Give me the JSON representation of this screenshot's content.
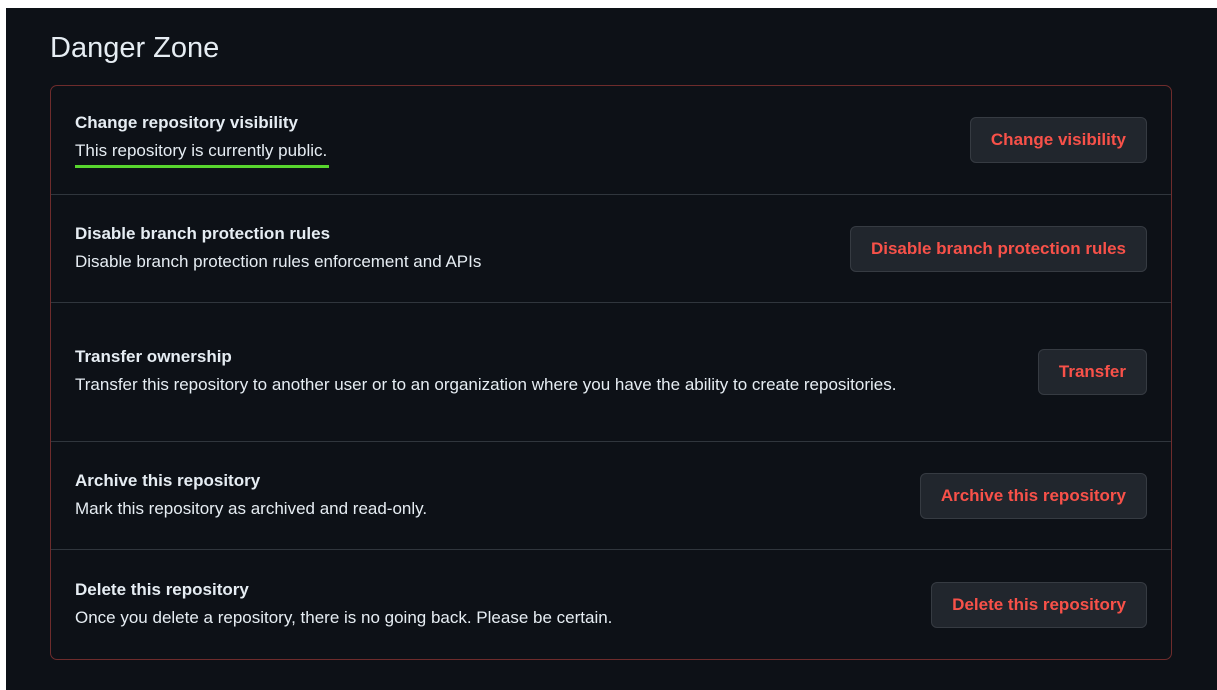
{
  "danger_zone": {
    "title": "Danger Zone",
    "accent_color": "#f85149",
    "highlight_color": "#58d62e",
    "items": [
      {
        "title": "Change repository visibility",
        "description": "This repository is currently public.",
        "button": "Change visibility",
        "highlighted": true
      },
      {
        "title": "Disable branch protection rules",
        "description": "Disable branch protection rules enforcement and APIs",
        "button": "Disable branch protection rules"
      },
      {
        "title": "Transfer ownership",
        "description": "Transfer this repository to another user or to an organization where you have the ability to create repositories.",
        "button": "Transfer"
      },
      {
        "title": "Archive this repository",
        "description": "Mark this repository as archived and read-only.",
        "button": "Archive this repository"
      },
      {
        "title": "Delete this repository",
        "description": "Once you delete a repository, there is no going back. Please be certain.",
        "button": "Delete this repository"
      }
    ]
  }
}
